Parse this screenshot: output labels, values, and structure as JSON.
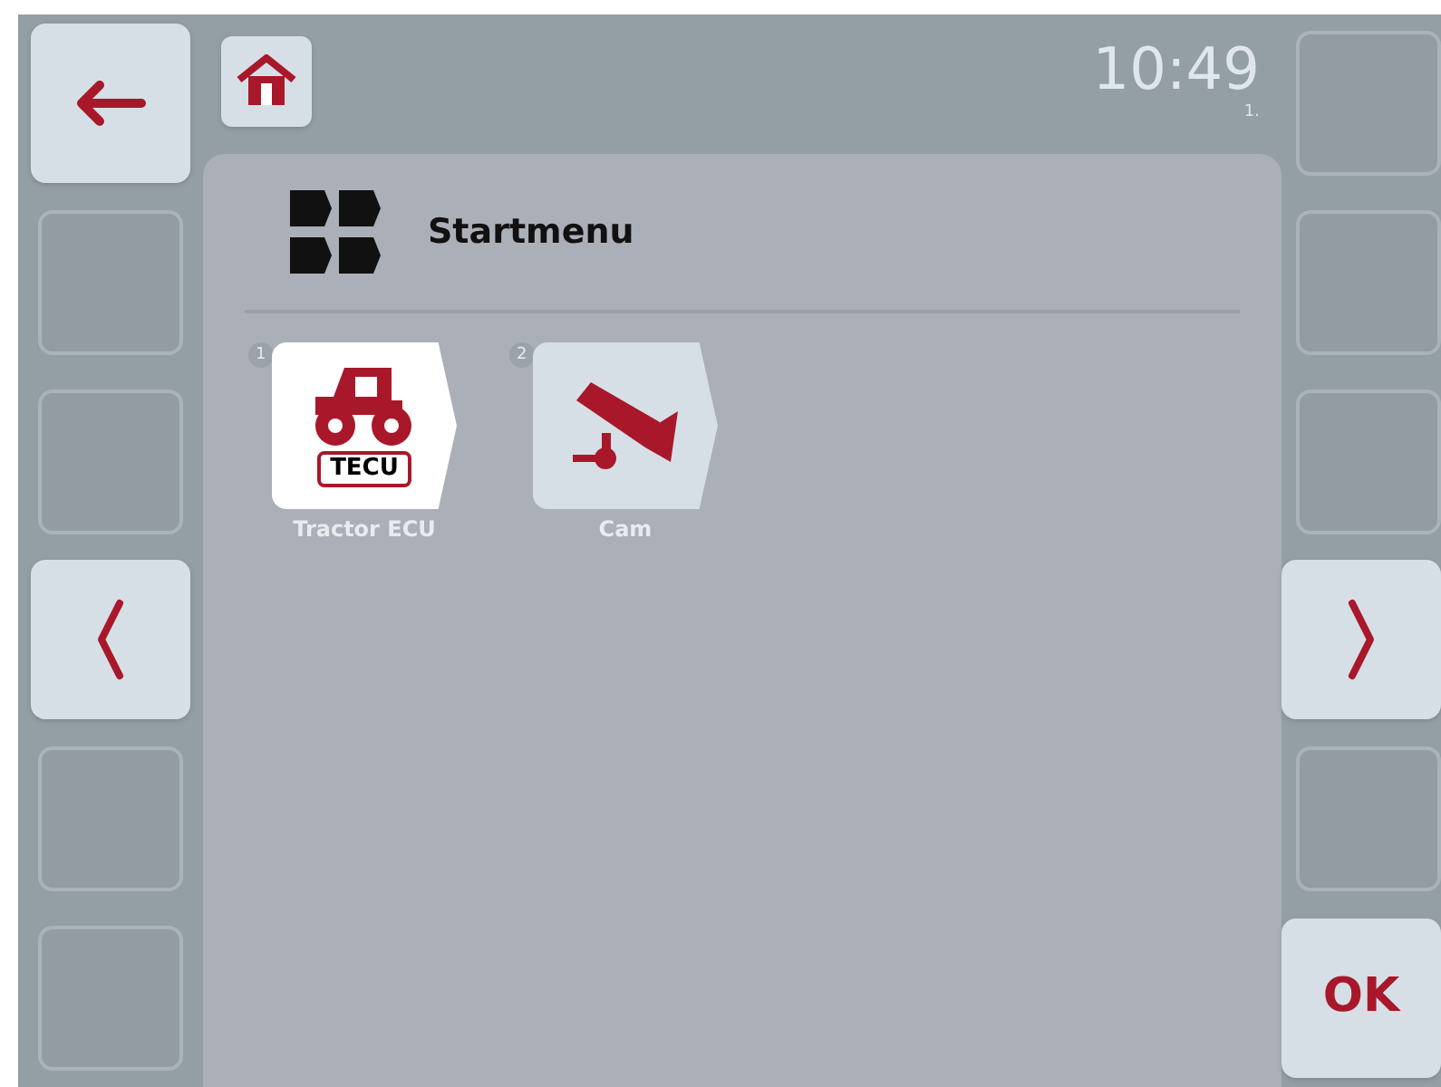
{
  "left_buttons": [
    {
      "kind": "back"
    },
    {
      "kind": "empty"
    },
    {
      "kind": "empty"
    },
    {
      "kind": "previous"
    },
    {
      "kind": "empty"
    },
    {
      "kind": "empty"
    }
  ],
  "header": {
    "time": "10:49",
    "page": "1."
  },
  "title": "Startmenu",
  "tiles": [
    {
      "number": "1",
      "label": "Tractor ECU",
      "kind": "tractor",
      "icon_text": "TECU",
      "selected": true
    },
    {
      "number": "2",
      "label": "Cam",
      "kind": "camera",
      "selected": false
    }
  ],
  "right_buttons": [
    {
      "kind": "empty"
    },
    {
      "kind": "empty"
    },
    {
      "kind": "empty"
    },
    {
      "kind": "next"
    },
    {
      "kind": "empty"
    },
    {
      "kind": "ok",
      "label": "OK"
    }
  ]
}
